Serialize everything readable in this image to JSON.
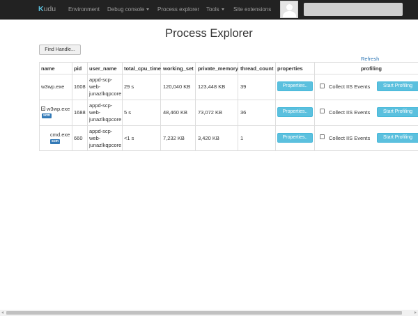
{
  "navbar": {
    "brand_k": "K",
    "brand_rest": "udu",
    "items": [
      {
        "label": "Environment"
      },
      {
        "label": "Debug console"
      },
      {
        "label": "Process explorer"
      },
      {
        "label": "Tools"
      },
      {
        "label": "Site extensions"
      }
    ]
  },
  "page": {
    "title": "Process Explorer",
    "find_handle_label": "Find Handle...",
    "refresh_label": "Refresh"
  },
  "table": {
    "headers": [
      "name",
      "pid",
      "user_name",
      "total_cpu_time",
      "working_set",
      "private_memory",
      "thread_count",
      "properties",
      "profiling"
    ],
    "rows": [
      {
        "name": "w3wp.exe",
        "pid": "1608",
        "user_name": [
          "appd-scp-",
          "web-",
          "junazlkqpcore"
        ],
        "total_cpu_time": "29 s",
        "working_set": "120,040 KB",
        "private_memory": "123,448 KB",
        "thread_count": "39",
        "properties_label": "Properties..",
        "collect_label": "Collect IIS Events",
        "profiling_label": "Start Profiling"
      },
      {
        "name": "w3wp.exe",
        "badge": "scm",
        "pid": "1688",
        "user_name": [
          "appd-scp-",
          "web-",
          "junazlkqpcore"
        ],
        "total_cpu_time": "5 s",
        "working_set": "48,460 KB",
        "private_memory": "73,072 KB",
        "thread_count": "36",
        "properties_label": "Properties..",
        "collect_label": "Collect IIS Events",
        "profiling_label": "Start Profiling"
      },
      {
        "name": "cmd.exe",
        "badge": "scm",
        "pid": "660",
        "user_name": [
          "appd-scp-",
          "web-",
          "junazlkqpcore"
        ],
        "total_cpu_time": "<1 s",
        "working_set": "7,232 KB",
        "private_memory": "3,420 KB",
        "thread_count": "1",
        "properties_label": "Properties..",
        "collect_label": "Collect IIS Events",
        "profiling_label": "Start Profiling"
      }
    ]
  },
  "colors": {
    "navbar_bg": "#222222",
    "accent": "#5bc0de",
    "badge": "#337ab7",
    "link": "#337ab7"
  }
}
